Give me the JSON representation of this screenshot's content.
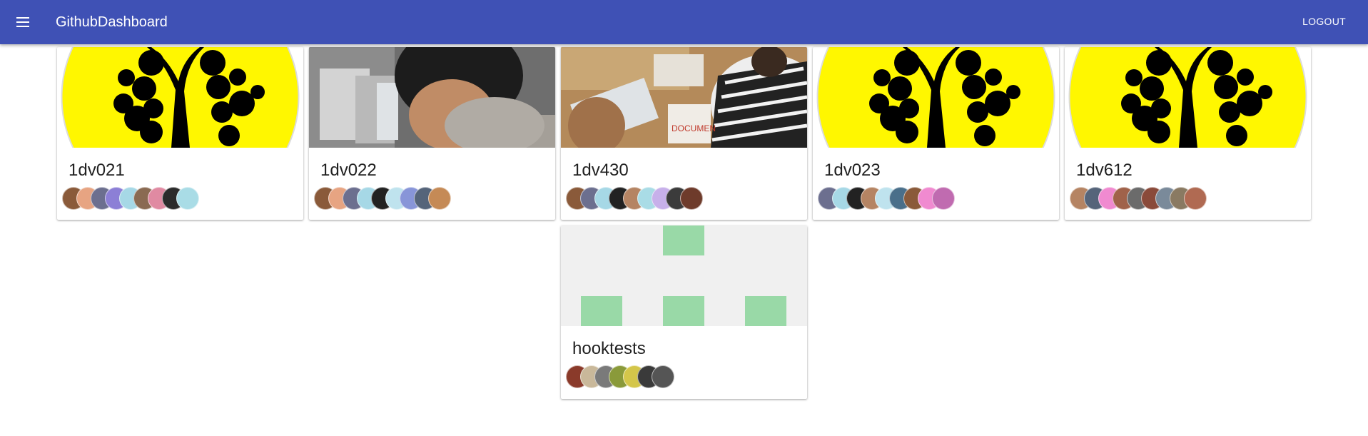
{
  "appbar": {
    "title": "GithubDashboard",
    "logout_label": "LOGOUT",
    "menu_icon": "menu-icon",
    "color": "#3f51b5"
  },
  "cards": [
    {
      "name": "1dv021",
      "media": "tree-logo",
      "avatar_count": 9
    },
    {
      "name": "1dv022",
      "media": "photo-person-computer",
      "avatar_count": 9
    },
    {
      "name": "1dv430",
      "media": "photo-people-laptop",
      "avatar_count": 9
    },
    {
      "name": "1dv023",
      "media": "tree-logo",
      "avatar_count": 9
    },
    {
      "name": "1dv612",
      "media": "tree-logo",
      "avatar_count": 9
    },
    {
      "name": "hooktests",
      "media": "identicon-green",
      "avatar_count": 7
    }
  ],
  "colors": {
    "logo_yellow": "#fff700",
    "identicon_green": "#99d9a7",
    "identicon_bg": "#f0f0f0"
  }
}
